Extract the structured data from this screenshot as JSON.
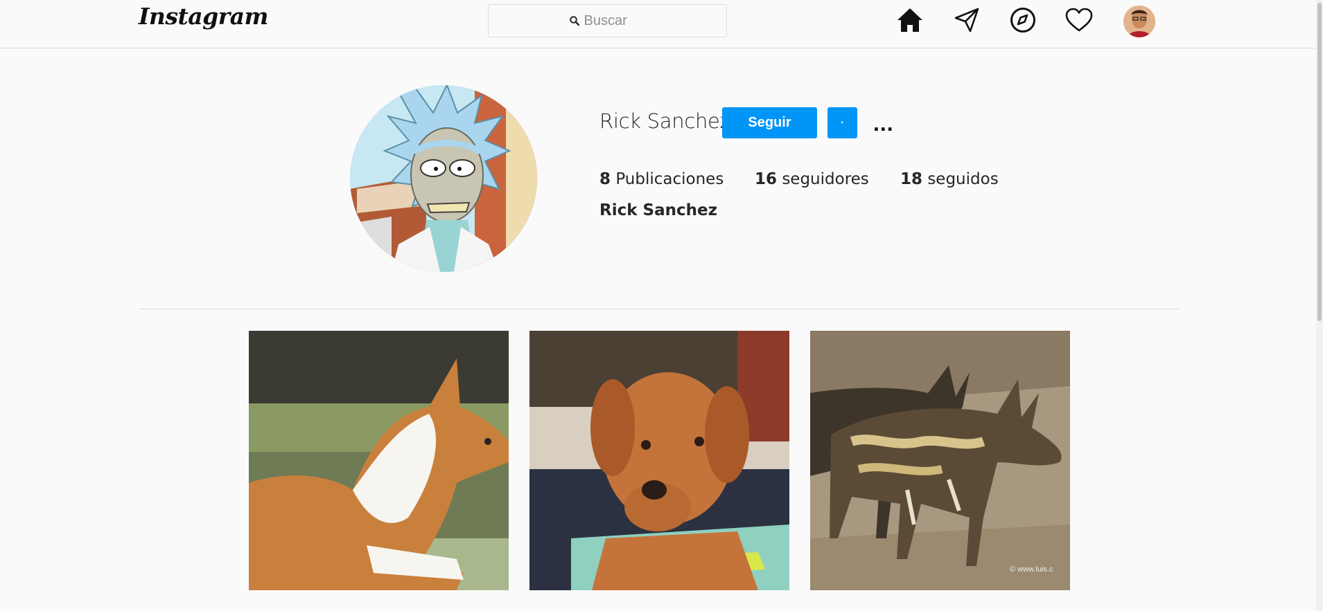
{
  "nav": {
    "logo": "Instagram",
    "search_placeholder": "Buscar",
    "icons": [
      "home-icon",
      "paper-plane-icon",
      "compass-icon",
      "heart-icon",
      "avatar"
    ]
  },
  "profile": {
    "username": "Rick Sanchez",
    "follow_label": "Seguir",
    "dot_label": "·",
    "more_label": "...",
    "stats": {
      "posts_count": "8",
      "posts_label": "Publicaciones",
      "followers_count": "16",
      "followers_label": "seguidores",
      "following_count": "18",
      "following_label": "seguidos"
    },
    "full_name": "Rick Sanchez"
  },
  "posts": [
    {
      "subject": "basenji-dog-photo"
    },
    {
      "subject": "rhodesian-ridgeback-puppy-photo"
    },
    {
      "subject": "african-wild-dogs-photo",
      "watermark": "© www.luis.c"
    }
  ],
  "colors": {
    "accent": "#0095f6",
    "background": "#fafafa",
    "border": "#dbdbdb"
  }
}
